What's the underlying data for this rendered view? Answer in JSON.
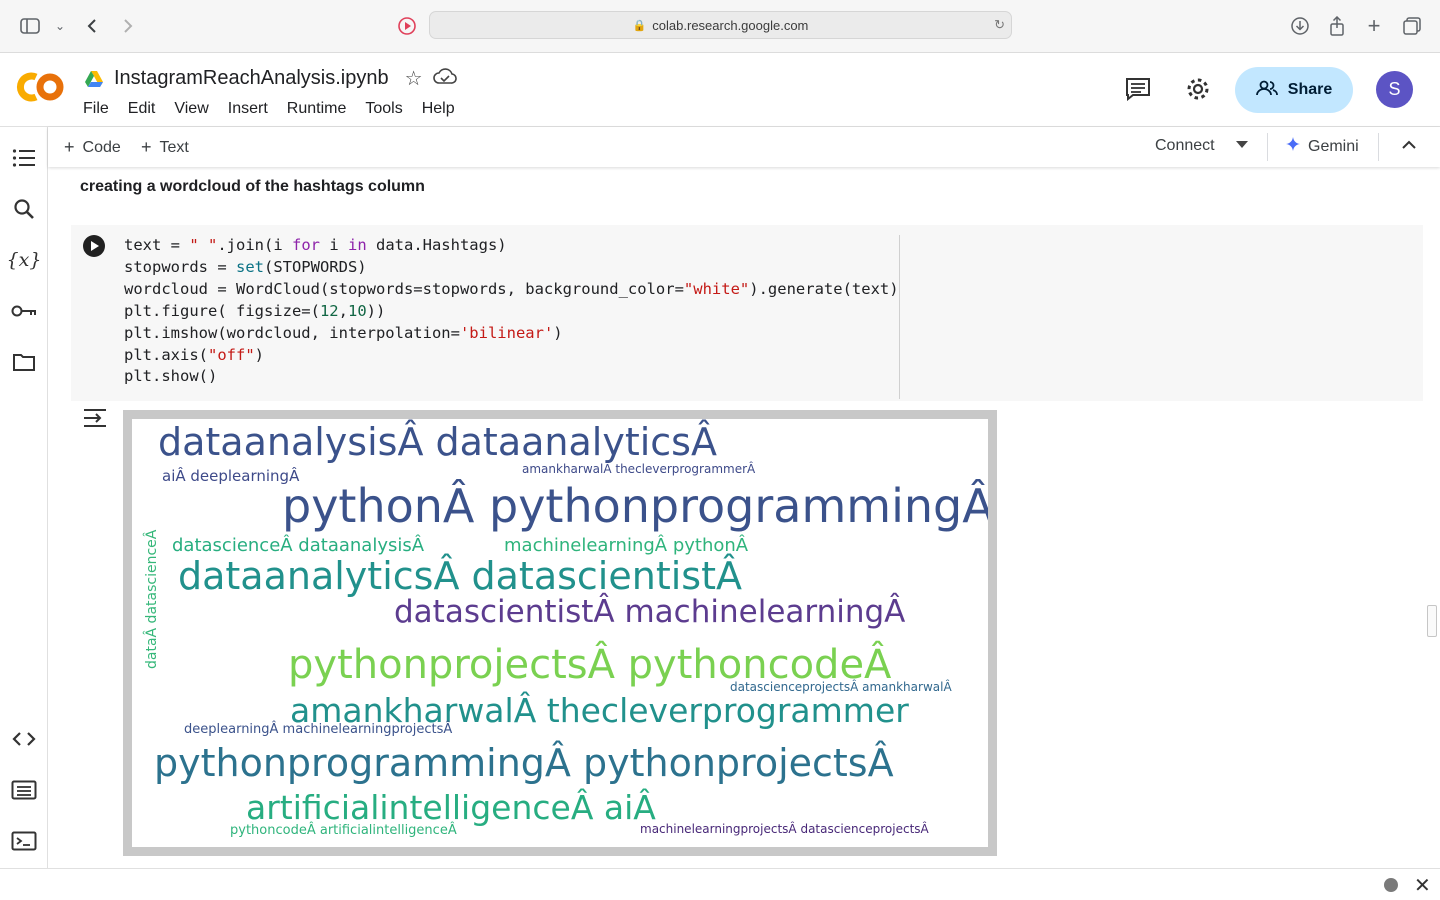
{
  "browser": {
    "url": "colab.research.google.com"
  },
  "notebook": {
    "title": "InstagramReachAnalysis.ipynb",
    "menu": [
      "File",
      "Edit",
      "View",
      "Insert",
      "Runtime",
      "Tools",
      "Help"
    ],
    "share_label": "Share",
    "avatar_letter": "S"
  },
  "toolbar": {
    "code_label": "Code",
    "text_label": "Text",
    "connect_label": "Connect",
    "gemini_label": "Gemini"
  },
  "cells": {
    "markdown_title": "creating a wordcloud of the hashtags column"
  },
  "wordcloud": {
    "words": [
      {
        "t": "dataanalysisÂ dataanalyticsÂ",
        "c": "#3b528b",
        "big": true
      },
      {
        "t": "pythonÂ pythonprogrammingÂ",
        "c": "#3b528b",
        "big": true
      },
      {
        "t": "dataanalyticsÂ datascientistÂ",
        "c": "#21918c",
        "big": true
      },
      {
        "t": "datascientistÂ machinelearningÂ",
        "c": "#5c3c8f",
        "big": true
      },
      {
        "t": "pythonprojectsÂ pythoncodeÂ",
        "c": "#7ad151",
        "big": true
      },
      {
        "t": "amankharwalÂ thecleverprogrammer",
        "c": "#21918c",
        "big": true
      },
      {
        "t": "pythonprogrammingÂ pythonprojectsÂ",
        "c": "#2c728e",
        "big": true
      },
      {
        "t": "artificialintelligenceÂ aiÂ",
        "c": "#27ad81",
        "big": true
      },
      {
        "t": "datascienceÂ dataanalysisÂ",
        "c": "#28ae80"
      },
      {
        "t": "machinelearningÂ pythonÂ",
        "c": "#2fb47c"
      },
      {
        "t": "aiÂ deeplearningÂ",
        "c": "#3e4a89"
      },
      {
        "t": "deeplearningÂ machinelearningprojectsÂ",
        "c": "#3b528b"
      },
      {
        "t": "pythoncodeÂ artificialintelligenceÂ",
        "c": "#2fb47c"
      },
      {
        "t": "machinelearningprojectsÂ datascienceprojectsÂ",
        "c": "#482878"
      },
      {
        "t": "amankharwalÂ thecleverprogrammerÂ",
        "c": "#3e4a89"
      },
      {
        "t": "datascienceprojectsÂ amankharwalÂ",
        "c": "#31688e"
      },
      {
        "t": "dataÂ datascienceÂ",
        "c": "#35b779"
      }
    ]
  }
}
